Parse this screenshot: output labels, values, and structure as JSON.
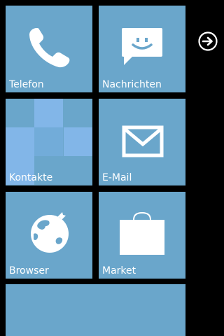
{
  "colors": {
    "background": "#000000",
    "tile": "#6aa6cb",
    "tile_text": "#ffffff",
    "mosaic_light": "#82b6e8"
  },
  "tiles": [
    {
      "label": "Telefon",
      "icon": "phone-icon"
    },
    {
      "label": "Nachrichten",
      "icon": "message-icon"
    },
    {
      "label": "Kontakte",
      "icon": "contacts-mosaic"
    },
    {
      "label": "E-Mail",
      "icon": "mail-icon"
    },
    {
      "label": "Browser",
      "icon": "globe-icon"
    },
    {
      "label": "Market",
      "icon": "shopping-bag-icon"
    },
    {
      "label": "",
      "icon": ""
    }
  ],
  "navigation": {
    "app_list_arrow_icon": "arrow-right-circle-icon"
  }
}
